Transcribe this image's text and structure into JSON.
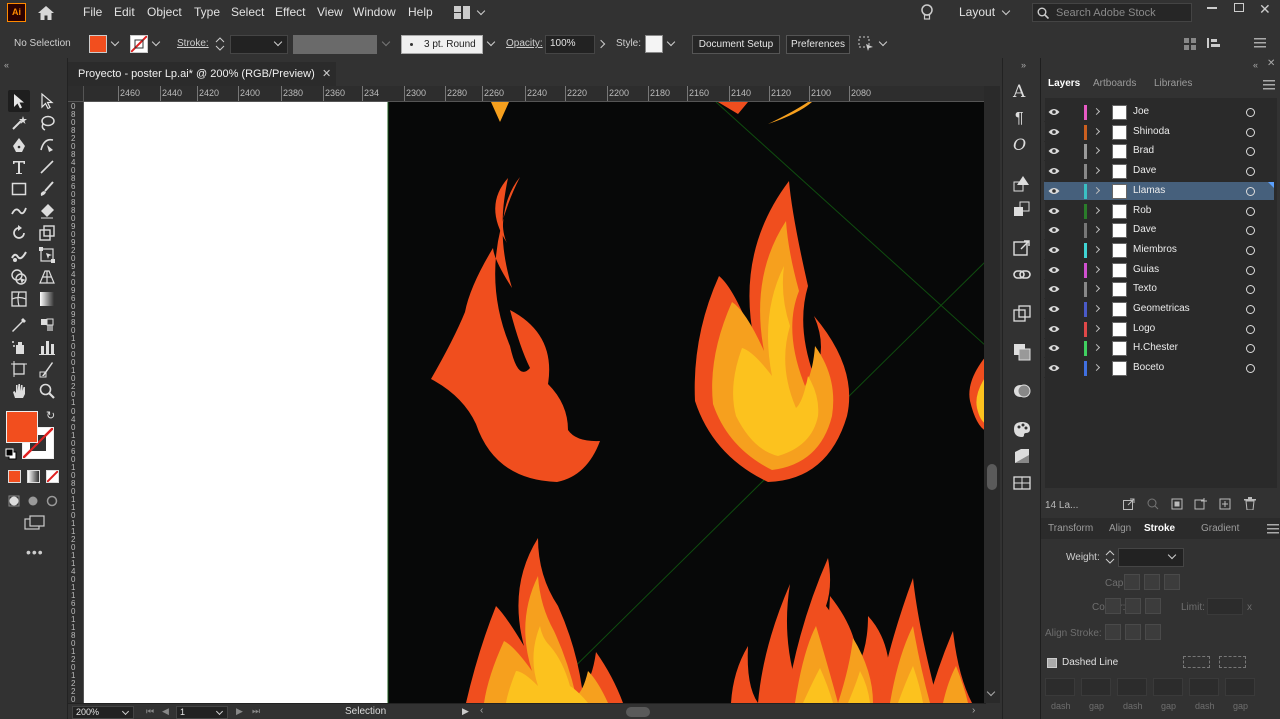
{
  "app": {
    "logo": "Ai",
    "menu": [
      "File",
      "Edit",
      "Object",
      "Type",
      "Select",
      "Effect",
      "View",
      "Window",
      "Help"
    ],
    "workspace": "Layout",
    "search_placeholder": "Search Adobe Stock"
  },
  "control_bar": {
    "selection": "No Selection",
    "stroke_label": "Stroke:",
    "brush": "3 pt. Round",
    "opacity_label": "Opacity:",
    "opacity_value": "100%",
    "style_label": "Style:",
    "document_setup": "Document Setup",
    "preferences": "Preferences",
    "fill_color": "#f24e1e"
  },
  "document": {
    "tab_title": "Proyecto - poster Lp.ai* @ 200% (RGB/Preview)",
    "h_ruler": [
      "2460",
      "2440",
      "2420",
      "2400",
      "2380",
      "2360",
      "234",
      "2300",
      "2280",
      "2260",
      "2240",
      "2220",
      "2200",
      "2180",
      "2160",
      "2140",
      "2120",
      "2100",
      "2080"
    ],
    "v_ruler": [
      "0",
      "8",
      "0",
      "8",
      "2",
      "0",
      "8",
      "4",
      "0",
      "8",
      "6",
      "0",
      "8",
      "8",
      "0",
      "9",
      "0",
      "9",
      "2",
      "0",
      "9",
      "4",
      "0",
      "9",
      "6",
      "0",
      "9",
      "8",
      "0",
      "1",
      "0",
      "0",
      "0",
      "1",
      "0",
      "2",
      "0",
      "1",
      "0",
      "4",
      "0",
      "1",
      "0",
      "6",
      "0",
      "1",
      "0",
      "8",
      "0",
      "1",
      "1",
      "0",
      "1",
      "1",
      "2",
      "0",
      "1",
      "1",
      "4",
      "0",
      "1",
      "1",
      "6",
      "0",
      "1",
      "1",
      "8",
      "0",
      "1",
      "2",
      "0",
      "1",
      "2",
      "2",
      "0"
    ],
    "artboard_color": "#070808",
    "flame_colors": {
      "dark": "#f04e1e",
      "mid": "#f6a01e",
      "light": "#fcc21e"
    }
  },
  "status": {
    "zoom": "200%",
    "artboard": "1",
    "tool": "Selection"
  },
  "panel": {
    "tabs": [
      "Layers",
      "Artboards",
      "Libraries"
    ],
    "layer_count": "14 La...",
    "layers": [
      {
        "name": "Joe",
        "color": "#e85ac4",
        "selected": false
      },
      {
        "name": "Shinoda",
        "color": "#cc6020",
        "selected": false
      },
      {
        "name": "Brad",
        "color": "#9a9a9a",
        "selected": false
      },
      {
        "name": "Dave",
        "color": "#888888",
        "selected": false
      },
      {
        "name": "Llamas",
        "color": "#3ac0c4",
        "selected": true
      },
      {
        "name": "Rob",
        "color": "#2a7d2a",
        "selected": false
      },
      {
        "name": "Dave",
        "color": "#777777",
        "selected": false
      },
      {
        "name": "Miembros",
        "color": "#40d4d4",
        "selected": false
      },
      {
        "name": "Guias",
        "color": "#d050d0",
        "selected": false
      },
      {
        "name": "Texto",
        "color": "#888888",
        "selected": false
      },
      {
        "name": "Geometricas",
        "color": "#4a5ac8",
        "selected": false
      },
      {
        "name": "Logo",
        "color": "#e04848",
        "selected": false
      },
      {
        "name": "H.Chester",
        "color": "#40d060",
        "selected": false
      },
      {
        "name": "Boceto",
        "color": "#4070e0",
        "selected": false
      }
    ],
    "stroke_tabs": [
      "Transform",
      "Align",
      "Stroke",
      "Gradient"
    ],
    "weight_label": "Weight:",
    "cap_label": "Cap:",
    "corner_label": "Corner:",
    "limit_label": "Limit:",
    "limit_unit": "x",
    "align_stroke_label": "Align Stroke:",
    "dashed_line": "Dashed Line",
    "dash_labels": [
      "dash",
      "gap",
      "dash",
      "gap",
      "dash",
      "gap"
    ]
  }
}
